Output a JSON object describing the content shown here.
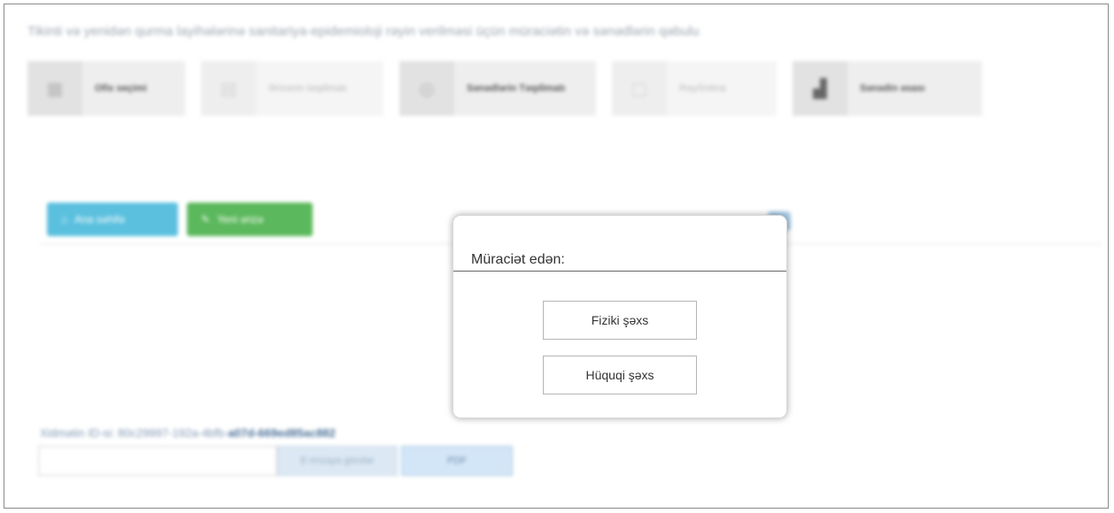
{
  "page": {
    "title": "Tikinti və yenidən qurma layihələrinə sanitariya-epidemioloji rəyin verilməsi üçün müraciətin və sənədlərin qəbulu"
  },
  "steps": [
    {
      "label": "Ofis seçimi",
      "icon": "building-icon"
    },
    {
      "label": "Ərizənin təqdimatı",
      "icon": "document-icon"
    },
    {
      "label": "Sənədlərin Təqdimatı",
      "icon": "globe-icon"
    },
    {
      "label": "Rəy/İmtina",
      "icon": "file-icon"
    },
    {
      "label": "Sənədin əsası",
      "icon": "chart-icon"
    }
  ],
  "actions": {
    "home_label": "Ana səhifə",
    "edit_label": "Yeni ərizə"
  },
  "service": {
    "label": "Xidmətin ID-si: 80c29997-192a-4bfb-",
    "id_suffix": "a07d-669ed85ac882"
  },
  "bottom": {
    "send_label": "E-imzaya göndər",
    "pdf_label": "PDF"
  },
  "modal": {
    "title": "Müraciət edən:",
    "options": [
      "Fiziki şəxs",
      "Hüquqi şəxs"
    ]
  },
  "colors": {
    "info": "#5bc0de",
    "success": "#5cb85c",
    "link": "#4a6f98"
  }
}
